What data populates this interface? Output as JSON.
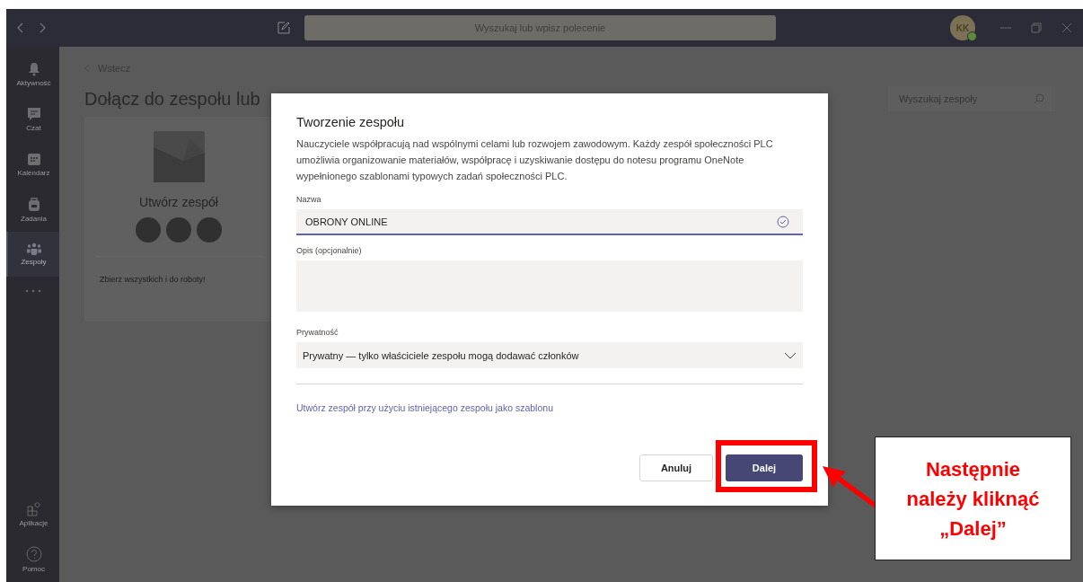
{
  "titlebar": {
    "search_placeholder": "Wyszukaj lub wpisz polecenie",
    "avatar_initials": "KK"
  },
  "sidebar": {
    "items": [
      {
        "label": "Aktywność",
        "selected": false
      },
      {
        "label": "Czat",
        "selected": false
      },
      {
        "label": "Kalendarz",
        "selected": false
      },
      {
        "label": "Zadania",
        "selected": false
      },
      {
        "label": "Zespoły",
        "selected": true
      }
    ],
    "bottom_items": [
      {
        "label": "Aplikacje"
      },
      {
        "label": "Pomoc"
      }
    ]
  },
  "page": {
    "back": "Wstecz",
    "title": "Dołącz do zespołu lub",
    "search_placeholder": "Wyszukaj zespoły",
    "card": {
      "title": "Utwórz zespół",
      "caption": "Zbierz wszystkich i do roboty!"
    }
  },
  "dialog": {
    "title": "Tworzenie zespołu",
    "description": "Nauczyciele współpracują nad wspólnymi celami lub rozwojem zawodowym. Każdy zespół społeczności PLC umożliwia organizowanie materiałów, współpracę i uzyskiwanie dostępu do notesu programu OneNote wypełnionego szablonami typowych zadań społeczności PLC.",
    "name_label": "Nazwa",
    "name_value": "OBRONY ONLINE",
    "description_label": "Opis (opcjonalnie)",
    "privacy_label": "Prywatność",
    "privacy_value": "Prywatny — tylko właściciele zespołu mogą dodawać członków",
    "template_link": "Utwórz zespół przy użyciu istniejącego zespołu jako szablonu",
    "buttons": [
      {
        "label": "Anuluj",
        "kind": "secondary"
      },
      {
        "label": "Dalej",
        "kind": "primary"
      }
    ]
  },
  "annotation": {
    "text": "Następnie\nnależy kliknąć\n„Dalej”"
  }
}
